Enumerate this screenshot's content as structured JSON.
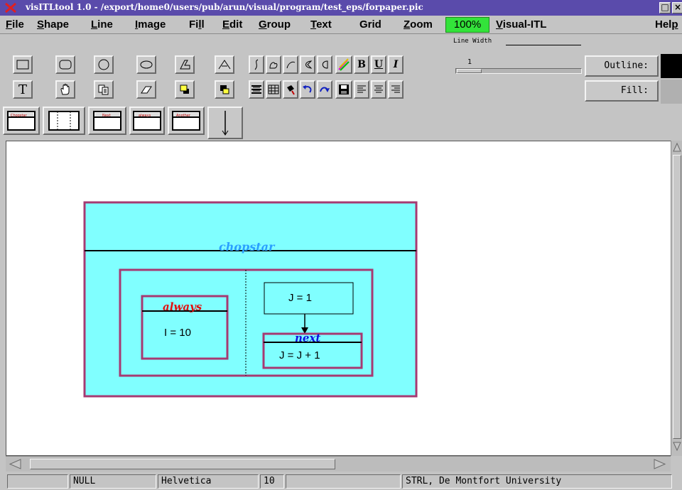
{
  "window": {
    "title": "visITLtool 1.0 - /export/home0/users/pub/arun/visual/program/test_eps/forpaper.pic",
    "controls": [
      "□",
      "×"
    ]
  },
  "menubar": {
    "items": [
      {
        "label": "File",
        "u": "F",
        "rest": "ile"
      },
      {
        "label": "Shape",
        "u": "S",
        "rest": "hape"
      },
      {
        "label": "Line",
        "u": "L",
        "rest": "ine"
      },
      {
        "label": "Image",
        "u": "I",
        "rest": "mage"
      },
      {
        "label": "Fill",
        "pre": "Fi",
        "u": "l",
        "rest": "l"
      },
      {
        "label": "Edit",
        "u": "E",
        "rest": "dit"
      },
      {
        "label": "Group",
        "u": "G",
        "rest": "roup"
      },
      {
        "label": "Text",
        "u": "T",
        "rest": "ext"
      },
      {
        "label": "Grid",
        "u": "",
        "rest": "Grid"
      },
      {
        "label": "Zoom",
        "u": "Z",
        "rest": "oom"
      },
      {
        "label": "Visual-ITL",
        "u": "V",
        "rest": "isual-ITL"
      },
      {
        "label": "Help",
        "pre": "Hel",
        "u": "p",
        "rest": ""
      }
    ],
    "zoom_value": "100%"
  },
  "toolbar": {
    "line_width_label": "Line Width",
    "line_width_value": "1",
    "line_width_fraction": 0.2,
    "outline_label": "Outline:",
    "fill_label": "Fill:",
    "outline_color": "#000000",
    "fill_color": "#b0b0b0",
    "bold_label": "B",
    "underline_label": "U",
    "italic_label": "I",
    "text_tool_label": "T",
    "template_labels": [
      "Chopstar",
      "",
      "Next",
      "always",
      "Another"
    ]
  },
  "diagram": {
    "chopstar_label": "chopstar",
    "always_label": "always",
    "always_body": "I = 10",
    "assign_body": "J = 1",
    "next_label": "next",
    "next_body": "J = J + 1",
    "colors": {
      "fill": "#80ffff",
      "border": "#a63a72",
      "chopstar_text": "#2aa0ff",
      "always_text": "#e01010",
      "next_text": "#1010e0"
    }
  },
  "status": {
    "field1": "",
    "field2": "NULL",
    "font": "Helvetica",
    "size": "10",
    "field5": "",
    "credit": "STRL, De Montfort University"
  }
}
